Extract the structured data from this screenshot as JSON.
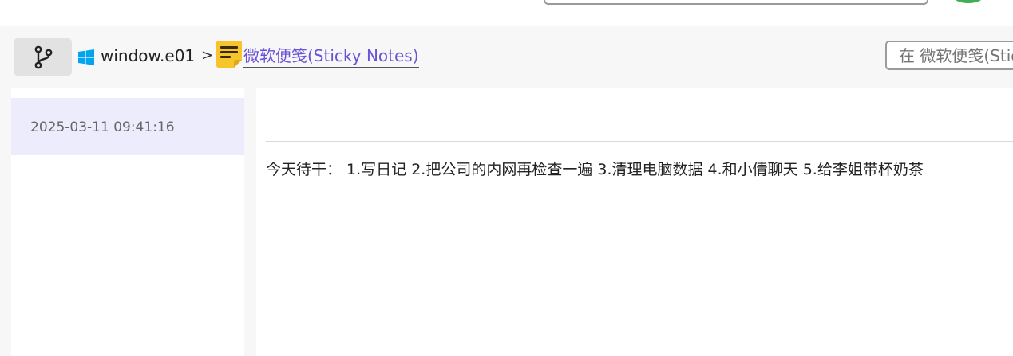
{
  "topbar": {
    "search": "",
    "avatar_color": "#3fae55"
  },
  "breadcrumb": {
    "branch_icon": "branch-icon",
    "os_icon": "windows-icon",
    "device": "window.e01",
    "separator": ">",
    "app_icon": "sticky-notes-icon",
    "app": "微软便笺(Sticky Notes)"
  },
  "search": {
    "placeholder": "在 微软便笺(Sticky Notes) 中搜索"
  },
  "notes_list": {
    "items": [
      {
        "time": "2025-03-11 09:41:16",
        "selected": true
      }
    ]
  },
  "note_detail": {
    "content": "今天待干：  1.写日记 2.把公司的内网再检查一遍 3.清理电脑数据 4.和小倩聊天 5.给李姐带杯奶茶"
  },
  "colors": {
    "accent": "#6a52d6",
    "selected_bg": "#ececfd",
    "sticky_yellow": "#f7c52b",
    "windows_blue": "#00a4ef"
  }
}
